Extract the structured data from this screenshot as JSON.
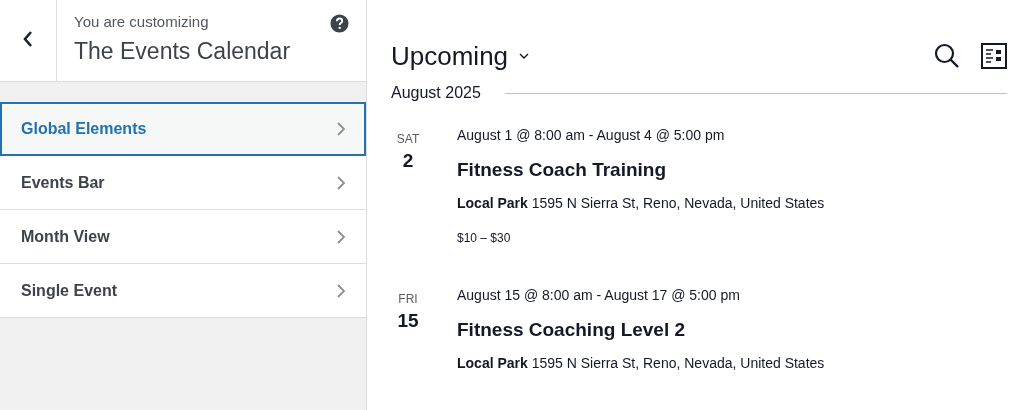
{
  "sidebar": {
    "header": {
      "eyebrow": "You are customizing",
      "title": "The Events Calendar"
    },
    "items": [
      {
        "label": "Global Elements",
        "selected": true
      },
      {
        "label": "Events Bar",
        "selected": false
      },
      {
        "label": "Month View",
        "selected": false
      },
      {
        "label": "Single Event",
        "selected": false
      }
    ]
  },
  "main": {
    "view_title": "Upcoming",
    "month": "August 2025",
    "events": [
      {
        "weekday": "SAT",
        "day": "2",
        "datetime": "August 1 @ 8:00 am - August 4 @ 5:00 pm",
        "title": "Fitness Coach Training",
        "venue": "**Local Park** 1595 N Sierra St, Reno, Nevada, United States",
        "price": "$10 – $30"
      },
      {
        "weekday": "FRI",
        "day": "15",
        "datetime": "August 15 @ 8:00 am - August 17 @ 5:00 pm",
        "title": "Fitness Coaching Level 2",
        "venue": "**Local Park** 1595 N Sierra St, Reno, Nevada, United States"
      }
    ]
  }
}
